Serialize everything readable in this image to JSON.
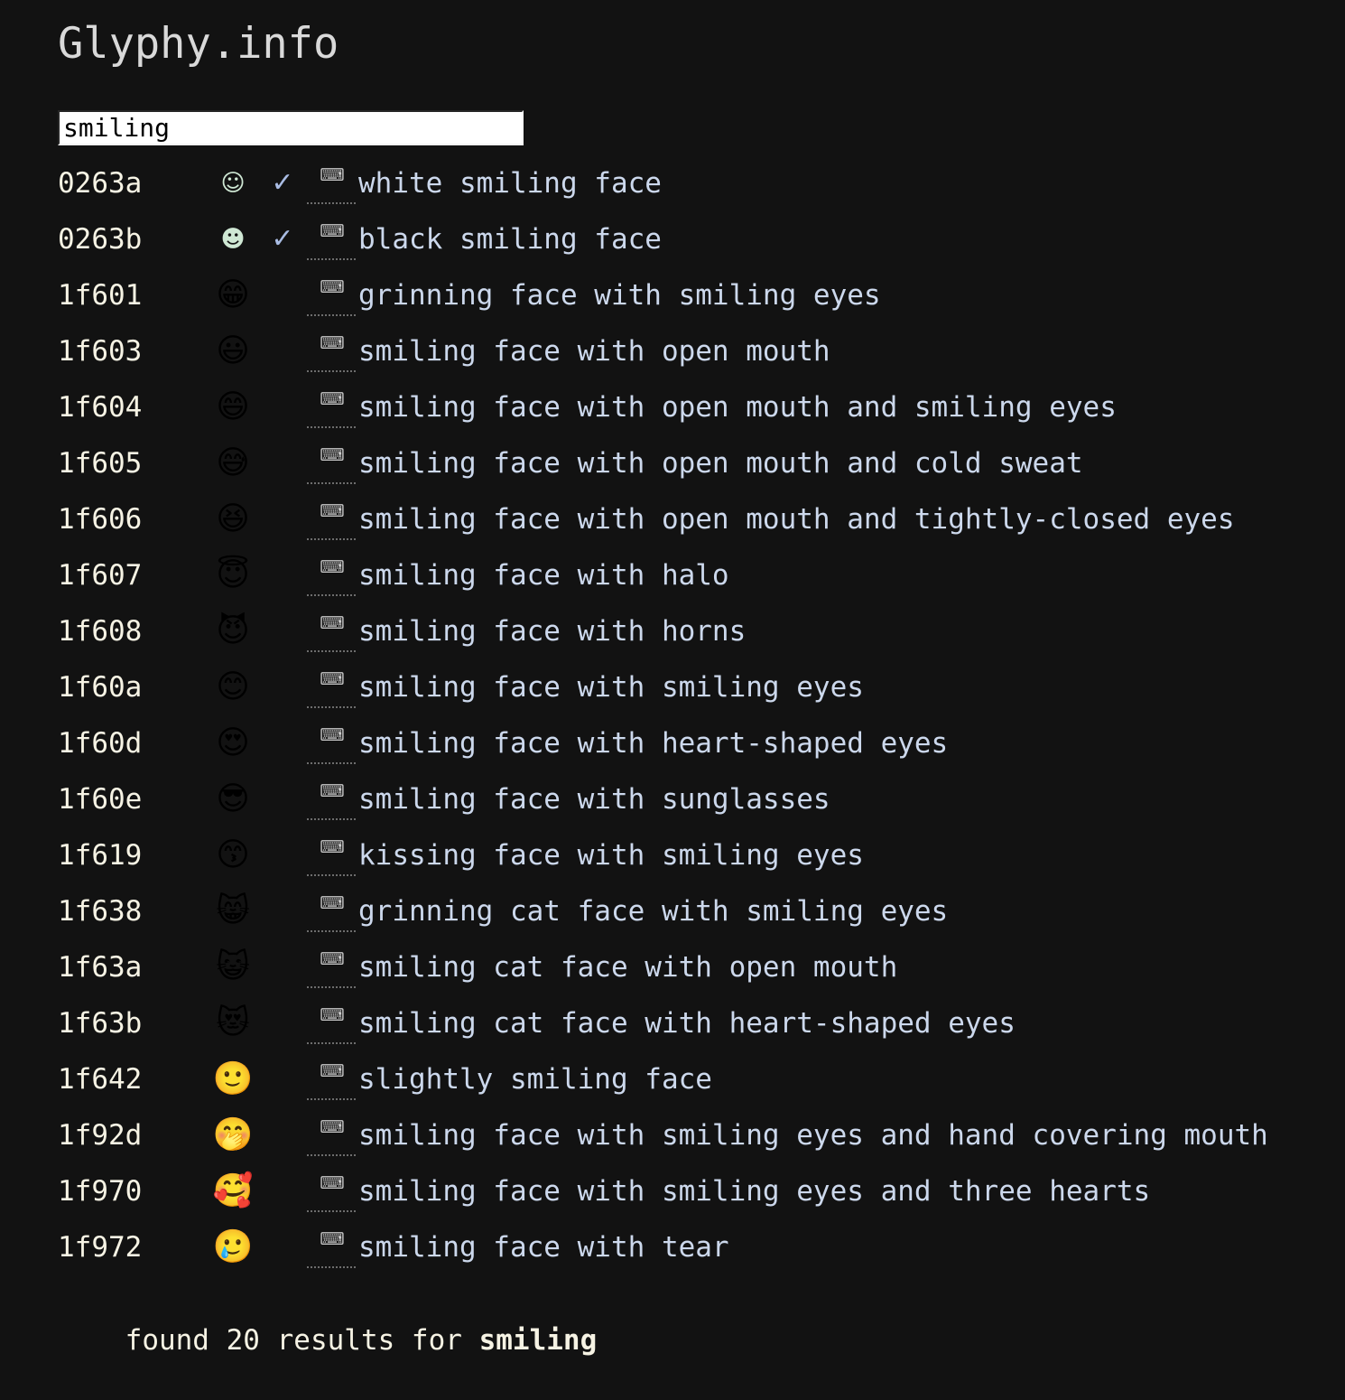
{
  "page": {
    "title": "Glyphy.info",
    "background_color": "#121212"
  },
  "search": {
    "value": "smiling",
    "placeholder": ""
  },
  "colors": {
    "codepoint": "#f6f3e4",
    "description": "#ccd8ec",
    "checkmark": "#a9bce3",
    "title": "#d9d9d9",
    "footer": "#f6f3e4"
  },
  "icons": {
    "keyboard": "⌨",
    "check": "✓"
  },
  "results": [
    {
      "codepoint": "0263a",
      "glyph": "☺",
      "glyph_style": "mono",
      "checked": true,
      "keyboard": true,
      "description": "white smiling face"
    },
    {
      "codepoint": "0263b",
      "glyph": "☻",
      "glyph_style": "mono",
      "checked": true,
      "keyboard": true,
      "description": "black smiling face"
    },
    {
      "codepoint": "1f601",
      "glyph": "😁",
      "glyph_style": "emoji",
      "checked": false,
      "keyboard": true,
      "description": "grinning face with smiling eyes"
    },
    {
      "codepoint": "1f603",
      "glyph": "😃",
      "glyph_style": "emoji",
      "checked": false,
      "keyboard": true,
      "description": "smiling face with open mouth"
    },
    {
      "codepoint": "1f604",
      "glyph": "😄",
      "glyph_style": "emoji",
      "checked": false,
      "keyboard": true,
      "description": "smiling face with open mouth and smiling eyes"
    },
    {
      "codepoint": "1f605",
      "glyph": "😅",
      "glyph_style": "emoji",
      "checked": false,
      "keyboard": true,
      "description": "smiling face with open mouth and cold sweat"
    },
    {
      "codepoint": "1f606",
      "glyph": "😆",
      "glyph_style": "emoji",
      "checked": false,
      "keyboard": true,
      "description": "smiling face with open mouth and tightly-closed eyes"
    },
    {
      "codepoint": "1f607",
      "glyph": "😇",
      "glyph_style": "emoji",
      "checked": false,
      "keyboard": true,
      "description": "smiling face with halo"
    },
    {
      "codepoint": "1f608",
      "glyph": "😈",
      "glyph_style": "emoji",
      "checked": false,
      "keyboard": true,
      "description": "smiling face with horns"
    },
    {
      "codepoint": "1f60a",
      "glyph": "😊",
      "glyph_style": "emoji",
      "checked": false,
      "keyboard": true,
      "description": "smiling face with smiling eyes"
    },
    {
      "codepoint": "1f60d",
      "glyph": "😍",
      "glyph_style": "emoji",
      "checked": false,
      "keyboard": true,
      "description": "smiling face with heart-shaped eyes"
    },
    {
      "codepoint": "1f60e",
      "glyph": "😎",
      "glyph_style": "emoji",
      "checked": false,
      "keyboard": true,
      "description": "smiling face with sunglasses"
    },
    {
      "codepoint": "1f619",
      "glyph": "😙",
      "glyph_style": "emoji",
      "checked": false,
      "keyboard": true,
      "description": "kissing face with smiling eyes"
    },
    {
      "codepoint": "1f638",
      "glyph": "😸",
      "glyph_style": "emoji",
      "checked": false,
      "keyboard": true,
      "description": "grinning cat face with smiling eyes"
    },
    {
      "codepoint": "1f63a",
      "glyph": "😺",
      "glyph_style": "emoji",
      "checked": false,
      "keyboard": true,
      "description": "smiling cat face with open mouth"
    },
    {
      "codepoint": "1f63b",
      "glyph": "😻",
      "glyph_style": "emoji",
      "checked": false,
      "keyboard": true,
      "description": "smiling cat face with heart-shaped eyes"
    },
    {
      "codepoint": "1f642",
      "glyph": "🙂",
      "glyph_style": "emoji",
      "checked": false,
      "keyboard": true,
      "description": "slightly smiling face"
    },
    {
      "codepoint": "1f92d",
      "glyph": "🤭",
      "glyph_style": "emoji",
      "checked": false,
      "keyboard": true,
      "description": "smiling face with smiling eyes and hand covering mouth"
    },
    {
      "codepoint": "1f970",
      "glyph": "🥰",
      "glyph_style": "emoji",
      "checked": false,
      "keyboard": true,
      "description": "smiling face with smiling eyes and three hearts"
    },
    {
      "codepoint": "1f972",
      "glyph": "🥲",
      "glyph_style": "emoji",
      "checked": false,
      "keyboard": true,
      "description": "smiling face with tear"
    }
  ],
  "footer": {
    "prefix": "found 20 results for ",
    "query": "smiling",
    "count": 20
  }
}
